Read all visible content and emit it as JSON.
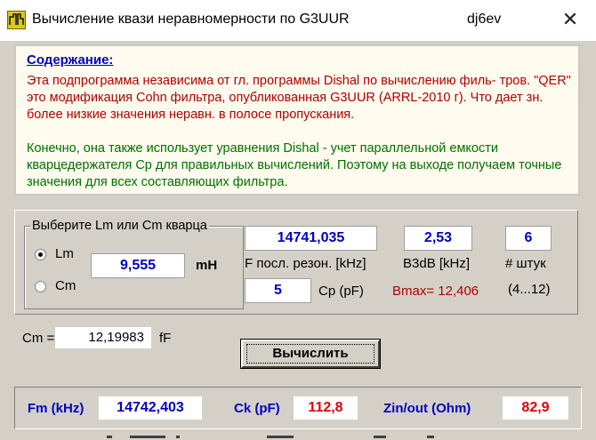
{
  "window": {
    "title": "Вычисление квази неравномерности по G3UUR",
    "author": "dj6ev",
    "close_glyph": "✕"
  },
  "info": {
    "heading": "Содержание:",
    "paragraph1": "Эта подпрограмма независима от гл. программы Dishal по вычислению филь- тров. \"QER\" это модификация Cohn фильтра, опубликованная G3UUR (ARRL-2010 г). Что дает зн. более низкие значения неравн. в полосе пропускания.",
    "paragraph2": "Конечно, она также использует уравнения Dishal  - учет параллельной емкости кварцедержателя Cp для правильных вычислений. Поэтому на выходе получаем точные значения для всех составляющих фильтра."
  },
  "selector": {
    "legend": "Выберите Lm или Cm кварца",
    "option_lm": "Lm",
    "option_cm": "Cm",
    "selected": "Lm",
    "value": "9,555",
    "unit": "mH"
  },
  "inputs": {
    "f_series": {
      "value": "14741,035",
      "label": "F посл. резон. [kHz]"
    },
    "b3db": {
      "value": "2,53",
      "label": "B3dB [kHz]"
    },
    "count": {
      "value": "6",
      "label": "# штук",
      "range": "(4...12)"
    },
    "cp": {
      "value": "5",
      "label": "Cp (pF)"
    },
    "bmax": "Bmax= 12,406"
  },
  "cm_result": {
    "label": "Cm =",
    "value": "12,19983",
    "unit": "fF"
  },
  "calculate_button": "Вычислить",
  "results": {
    "fm": {
      "label": "Fm (kHz)",
      "value": "14742,403"
    },
    "ck": {
      "label": "Ck (pF)",
      "value": "112,8"
    },
    "zin": {
      "label": "Zin/out (Ohm)",
      "value": "82,9"
    }
  },
  "colors": {
    "accent_blue": "#0000c0",
    "value_red": "#e00000",
    "heading_blue": "#0000c8",
    "text_red": "#b00000",
    "text_green": "#007000",
    "panel_gray": "#d4d0c8"
  }
}
